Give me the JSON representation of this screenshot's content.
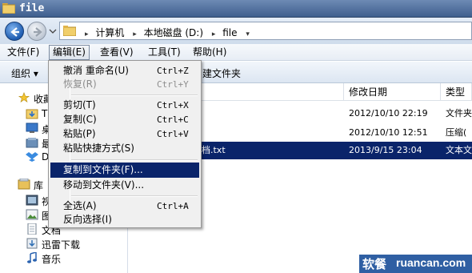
{
  "window": {
    "title": "file"
  },
  "address": {
    "crumbs": [
      "计算机",
      "本地磁盘 (D:)",
      "file"
    ]
  },
  "menubar": [
    {
      "label": "文件(F)"
    },
    {
      "label": "编辑(E)"
    },
    {
      "label": "查看(V)"
    },
    {
      "label": "工具(T)"
    },
    {
      "label": "帮助(H)"
    }
  ],
  "toolbar": {
    "organize": "组织 ▾",
    "new_folder_partial": "建文件夹"
  },
  "nav": {
    "favorites_partial": "收藏",
    "fav_items_partial": [
      "T",
      "桌",
      "最",
      "Dr"
    ],
    "library_partial": "库",
    "lib_items_partial": [
      "视",
      "图"
    ],
    "documents_partial": "文档",
    "xunlei": "迅雷下载",
    "music": "音乐"
  },
  "columns": {
    "modified": "修改日期",
    "type": "类型"
  },
  "rows": [
    {
      "name": "",
      "modified": "2012/10/10 22:19",
      "type": "文件夹"
    },
    {
      "name": "",
      "modified": "2012/10/10 12:51",
      "type": "压缩("
    },
    {
      "name": "文档.txt",
      "modified": "2013/9/15 23:04",
      "type": "文本文"
    }
  ],
  "edit_menu": {
    "undo": {
      "label": "撤消 重命名(U)",
      "shortcut": "Ctrl+Z"
    },
    "redo": {
      "label": "恢复(R)",
      "shortcut": "Ctrl+Y"
    },
    "cut": {
      "label": "剪切(T)",
      "shortcut": "Ctrl+X"
    },
    "copy": {
      "label": "复制(C)",
      "shortcut": "Ctrl+C"
    },
    "paste": {
      "label": "粘贴(P)",
      "shortcut": "Ctrl+V"
    },
    "paste_shortcut": {
      "label": "粘贴快捷方式(S)"
    },
    "copy_to": {
      "label": "复制到文件夹(F)..."
    },
    "move_to": {
      "label": "移动到文件夹(V)..."
    },
    "select_all": {
      "label": "全选(A)",
      "shortcut": "Ctrl+A"
    },
    "invert": {
      "label": "反向选择(I)"
    }
  },
  "watermark": {
    "cn": "软餐",
    "en": "ruancan.com"
  },
  "colors": {
    "selection": "#0a246a",
    "titlebar": "#4f6f9e",
    "folder": "#e8c15a",
    "watermark": "#2f5fa3"
  }
}
